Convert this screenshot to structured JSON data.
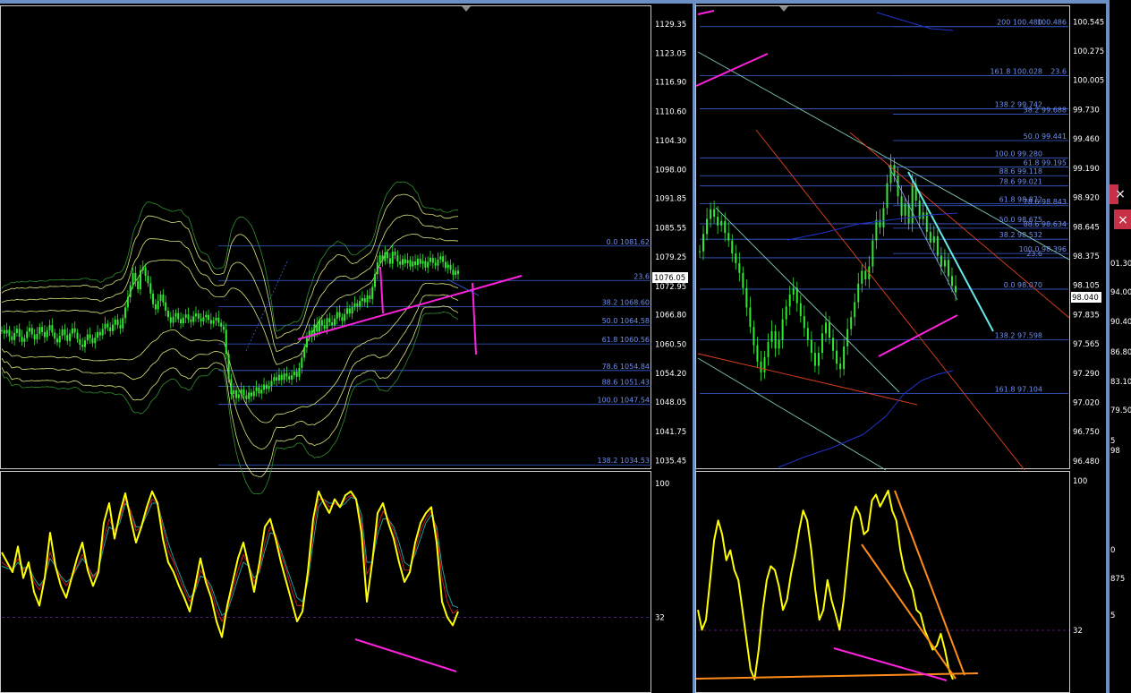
{
  "colors": {
    "background": "#000000",
    "window_frame": "#6c8fc4",
    "axis_text": "#ffffff",
    "fib_line": "#3b5fd6",
    "fib_label": "#6f8ff0",
    "candle": "#33e833",
    "band": "#d8e57a",
    "envelope": "#2f8f2f",
    "annotation": "#ff22dd",
    "oscillator": "#ffff00",
    "signal_red": "#d01818",
    "signal_teal": "#19a0a0",
    "trend_orange": "#ff8c1a",
    "trend_cyan": "#66e8e8",
    "channel_red": "#e0401c",
    "ma_blue": "#2233cc",
    "close_button": "#e04060"
  },
  "price_box_left": "1076.05",
  "price_box_right": "98.040",
  "osc_marker_32": "32",
  "partial_labels": [
    "01.30",
    "94.00",
    "90.40",
    "86.80",
    "83.10",
    "79.50",
    "5",
    "98",
    "0",
    "875",
    "5"
  ],
  "chart_data": [
    {
      "type": "line",
      "panel": "left-price",
      "yaxis_ticks": [
        "1129.35",
        "1123.05",
        "1116.90",
        "1110.60",
        "1104.30",
        "1098.00",
        "1091.85",
        "1085.55",
        "1079.25",
        "1072.95",
        "1066.80",
        "1060.50",
        "1054.20",
        "1048.05",
        "1041.75",
        "1035.45"
      ],
      "ylim": [
        1034.0,
        1133.0
      ],
      "fib_levels": [
        {
          "label": "0.0 1081.62",
          "value": 1081.62
        },
        {
          "label": "23.6",
          "value": 1074.2
        },
        {
          "label": "38.2 1068.60",
          "value": 1068.6
        },
        {
          "label": "50.0 1064.58",
          "value": 1064.58
        },
        {
          "label": "61.8 1060.56",
          "value": 1060.56
        },
        {
          "label": "78.6 1054.84",
          "value": 1054.84
        },
        {
          "label": "88.6 1051.43",
          "value": 1051.43
        },
        {
          "label": "100.0 1047.54",
          "value": 1047.54
        },
        {
          "label": "138.2 1034.53",
          "value": 1034.53
        }
      ],
      "close": [
        1063.5,
        1062.8,
        1063.6,
        1062.2,
        1061.4,
        1062.9,
        1063.8,
        1062.1,
        1061.0,
        1061.8,
        1063.2,
        1064.0,
        1062.6,
        1061.5,
        1062.7,
        1064.2,
        1063.1,
        1062.0,
        1063.5,
        1064.6,
        1063.0,
        1061.7,
        1060.9,
        1062.3,
        1063.7,
        1062.5,
        1061.2,
        1062.8,
        1063.9,
        1063.0,
        1061.6,
        1060.4,
        1059.9,
        1061.3,
        1062.6,
        1061.8,
        1060.7,
        1061.9,
        1063.1,
        1062.4,
        1063.8,
        1064.9,
        1064.1,
        1063.3,
        1064.7,
        1065.8,
        1064.6,
        1063.9,
        1066.1,
        1068.4,
        1070.6,
        1073.2,
        1075.8,
        1074.1,
        1072.3,
        1076.4,
        1077.0,
        1075.2,
        1073.6,
        1071.4,
        1069.1,
        1068.0,
        1069.8,
        1071.2,
        1069.5,
        1067.7,
        1066.3,
        1065.1,
        1066.4,
        1067.2,
        1065.9,
        1065.0,
        1066.2,
        1066.9,
        1065.8,
        1065.3,
        1066.5,
        1067.1,
        1066.0,
        1065.4,
        1066.3,
        1066.8,
        1065.7,
        1064.9,
        1065.6,
        1066.2,
        1065.1,
        1064.3,
        1063.6,
        1058.4,
        1053.0,
        1049.8,
        1050.6,
        1048.9,
        1049.7,
        1050.8,
        1049.5,
        1048.7,
        1050.1,
        1049.3,
        1050.4,
        1051.2,
        1049.9,
        1050.7,
        1051.8,
        1050.9,
        1051.5,
        1052.6,
        1053.4,
        1052.7,
        1053.9,
        1052.8,
        1054.2,
        1053.6,
        1052.9,
        1053.8,
        1054.6,
        1053.5,
        1055.4,
        1057.6,
        1059.8,
        1061.9,
        1063.4,
        1062.1,
        1064.8,
        1063.2,
        1065.7,
        1064.5,
        1063.8,
        1066.1,
        1065.2,
        1064.6,
        1066.0,
        1067.4,
        1066.3,
        1065.5,
        1067.0,
        1068.2,
        1067.1,
        1068.5,
        1069.3,
        1068.6,
        1069.8,
        1070.4,
        1069.5,
        1071.0,
        1070.2,
        1072.8,
        1075.6,
        1078.1,
        1079.6,
        1078.4,
        1080.2,
        1079.0,
        1077.8,
        1080.4,
        1079.6,
        1078.3,
        1077.6,
        1078.8,
        1077.9,
        1078.6,
        1077.2,
        1078.3,
        1077.5,
        1078.9,
        1077.8,
        1078.4,
        1077.0,
        1078.2,
        1079.1,
        1078.0,
        1077.4,
        1078.7,
        1079.4,
        1078.2,
        1076.9,
        1077.6,
        1076.5,
        1075.4,
        1076.3,
        1075.6
      ]
    },
    {
      "type": "line",
      "panel": "right-price",
      "yaxis_ticks": [
        "100.545",
        "100.275",
        "100.005",
        "99.730",
        "99.460",
        "99.190",
        "98.920",
        "98.645",
        "98.375",
        "98.105",
        "97.835",
        "97.565",
        "97.290",
        "97.020",
        "96.750",
        "96.480"
      ],
      "ylim": [
        96.42,
        100.68
      ],
      "fib_levels": [
        {
          "label": "200 100.480",
          "value": 100.5,
          "side": "mid"
        },
        {
          "label": "100.486",
          "value": 100.5,
          "side": "right"
        },
        {
          "label": "161.8 100.028",
          "value": 100.045,
          "side": "mid"
        },
        {
          "label": "23.6",
          "value": 100.045,
          "side": "right"
        },
        {
          "label": "138.2 99.742",
          "value": 99.74,
          "side": "mid"
        },
        {
          "label": "38.2 99.688",
          "value": 99.69,
          "side": "right"
        },
        {
          "label": "50.0 99.441",
          "value": 99.445,
          "side": "right"
        },
        {
          "label": "100.0 99.280",
          "value": 99.285,
          "side": "mid"
        },
        {
          "label": "61.8 99.195",
          "value": 99.2,
          "side": "right"
        },
        {
          "label": "88.6 99.118",
          "value": 99.12,
          "side": "mid"
        },
        {
          "label": "78.6 99.021",
          "value": 99.025,
          "side": "mid"
        },
        {
          "label": "61.8 98.872",
          "value": 98.862,
          "side": "mid"
        },
        {
          "label": "78.6 98.843",
          "value": 98.842,
          "side": "right"
        },
        {
          "label": "50.0 98.675",
          "value": 98.675,
          "side": "mid"
        },
        {
          "label": "88.6 98.634",
          "value": 98.634,
          "side": "right"
        },
        {
          "label": "38.2 98.532",
          "value": 98.532,
          "side": "mid"
        },
        {
          "label": "100.0 98.396",
          "value": 98.4,
          "side": "right"
        },
        {
          "label": "23.6",
          "value": 98.36,
          "side": "mid"
        },
        {
          "label": "0.0 98.070",
          "value": 98.07,
          "side": "mid"
        },
        {
          "label": "138.2 97.598",
          "value": 97.6,
          "side": "mid"
        },
        {
          "label": "161.8 97.104",
          "value": 97.105,
          "side": "mid"
        }
      ],
      "close": [
        98.42,
        98.58,
        98.72,
        98.81,
        98.74,
        98.66,
        98.7,
        98.59,
        98.52,
        98.4,
        98.31,
        98.22,
        98.08,
        97.9,
        97.72,
        97.55,
        97.4,
        97.3,
        97.44,
        97.58,
        97.68,
        97.52,
        97.6,
        97.79,
        97.91,
        98.02,
        98.08,
        97.94,
        97.82,
        97.71,
        97.6,
        97.48,
        97.36,
        97.48,
        97.66,
        97.76,
        97.62,
        97.5,
        97.38,
        97.33,
        97.54,
        97.7,
        97.81,
        97.95,
        98.12,
        98.24,
        98.16,
        98.28,
        98.52,
        98.71,
        98.64,
        98.82,
        99.05,
        99.22,
        99.12,
        98.93,
        98.75,
        98.86,
        98.68,
        99.04,
        98.89,
        98.72,
        98.78,
        98.6,
        98.5,
        98.56,
        98.38,
        98.28,
        98.34,
        98.19,
        98.1,
        98.04
      ]
    },
    {
      "type": "line",
      "panel": "left-oscillator",
      "yaxis_ticks": [
        "100",
        "32"
      ],
      "ylim": [
        0,
        100
      ],
      "series": [
        {
          "values": [
            65,
            60,
            55,
            68,
            52,
            60,
            45,
            38,
            52,
            75,
            58,
            48,
            42,
            52,
            62,
            70,
            56,
            48,
            55,
            80,
            90,
            72,
            85,
            95,
            82,
            70,
            78,
            88,
            96,
            90,
            72,
            60,
            55,
            48,
            42,
            35,
            48,
            62,
            50,
            42,
            30,
            22,
            38,
            50,
            62,
            70,
            58,
            45,
            60,
            78,
            82,
            72,
            60,
            50,
            40,
            30,
            35,
            55,
            82,
            96,
            90,
            85,
            92,
            88,
            94,
            96,
            92,
            75,
            40,
            60,
            85,
            90,
            80,
            72,
            60,
            50,
            55,
            70,
            80,
            85,
            88,
            70,
            40,
            32,
            28,
            35
          ]
        },
        {
          "values": [
            60,
            58,
            57,
            62,
            56,
            58,
            50,
            46,
            52,
            65,
            58,
            52,
            48,
            52,
            58,
            64,
            58,
            52,
            56,
            72,
            82,
            76,
            82,
            92,
            86,
            76,
            78,
            86,
            92,
            90,
            78,
            66,
            60,
            52,
            46,
            40,
            46,
            56,
            52,
            46,
            36,
            30,
            36,
            46,
            56,
            64,
            58,
            50,
            56,
            70,
            78,
            74,
            64,
            56,
            46,
            38,
            38,
            52,
            76,
            92,
            92,
            88,
            90,
            88,
            92,
            94,
            92,
            80,
            54,
            60,
            78,
            86,
            82,
            76,
            66,
            56,
            56,
            66,
            76,
            82,
            86,
            76,
            52,
            40,
            34,
            36
          ]
        },
        {
          "values": [
            58,
            57,
            56,
            60,
            57,
            58,
            52,
            48,
            52,
            62,
            58,
            53,
            50,
            52,
            57,
            62,
            58,
            53,
            56,
            68,
            78,
            76,
            80,
            90,
            86,
            78,
            78,
            84,
            90,
            90,
            80,
            70,
            62,
            55,
            48,
            42,
            45,
            53,
            52,
            48,
            40,
            33,
            35,
            43,
            52,
            60,
            58,
            52,
            55,
            66,
            75,
            74,
            66,
            58,
            50,
            42,
            40,
            50,
            70,
            88,
            92,
            90,
            90,
            88,
            90,
            93,
            92,
            84,
            60,
            60,
            74,
            82,
            82,
            78,
            70,
            60,
            58,
            64,
            72,
            80,
            84,
            78,
            58,
            45,
            38,
            37
          ]
        }
      ]
    },
    {
      "type": "line",
      "panel": "right-oscillator",
      "yaxis_ticks": [
        "100",
        "32"
      ],
      "ylim": [
        0,
        100
      ],
      "series": [
        {
          "values": [
            40,
            30,
            35,
            55,
            75,
            85,
            78,
            65,
            70,
            60,
            55,
            40,
            25,
            10,
            5,
            20,
            40,
            55,
            62,
            60,
            52,
            40,
            45,
            58,
            68,
            80,
            90,
            85,
            70,
            50,
            35,
            40,
            55,
            45,
            38,
            30,
            45,
            65,
            85,
            92,
            88,
            78,
            80,
            95,
            98,
            92,
            96,
            100,
            90,
            85,
            70,
            60,
            55,
            50,
            40,
            38,
            30,
            25,
            20,
            22,
            28,
            20,
            10,
            5
          ]
        }
      ]
    }
  ]
}
